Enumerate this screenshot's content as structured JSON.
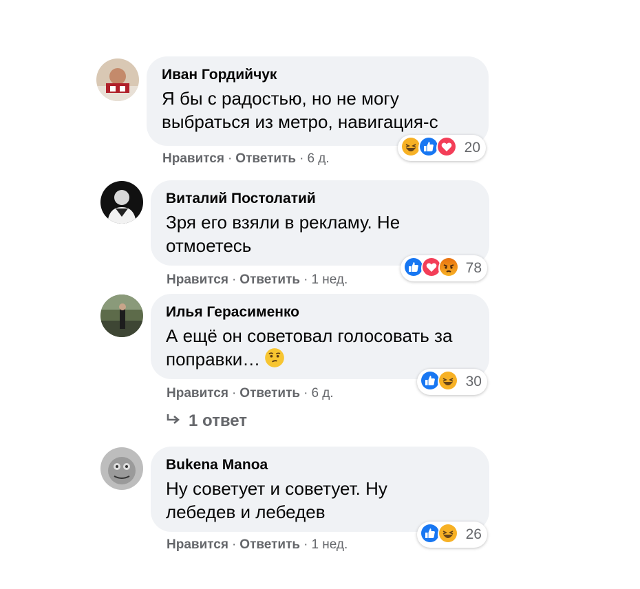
{
  "comments": [
    {
      "author": "Иван Гордийчук",
      "text": "Я бы с радостью, но не могу выбраться из метро, навигация-с",
      "like": "Нравится",
      "reply": "Ответить",
      "time": "6 д.",
      "reactions": [
        "haha",
        "like",
        "love"
      ],
      "reaction_count": "20"
    },
    {
      "author": "Виталий Постолатий",
      "text": "Зря его взяли в рекламу. Не отмоетесь",
      "like": "Нравится",
      "reply": "Ответить",
      "time": "1 нед.",
      "reactions": [
        "like",
        "love",
        "angry"
      ],
      "reaction_count": "78"
    },
    {
      "author": "Илья Герасименко",
      "text": "А ещё он советовал голосовать за поправки…",
      "like": "Нравится",
      "reply": "Ответить",
      "time": "6 д.",
      "reactions": [
        "like",
        "haha"
      ],
      "reaction_count": "30",
      "replies_link": "1 ответ"
    },
    {
      "author": "Bukena Manoa",
      "text": "Ну советует и советует. Ну лебедев и лебедев",
      "like": "Нравится",
      "reply": "Ответить",
      "time": "1 нед.",
      "reactions": [
        "like",
        "haha"
      ],
      "reaction_count": "26"
    }
  ],
  "colors": {
    "bubble": "#f0f2f5",
    "meta": "#65676b",
    "like_blue": "#1877f2",
    "love_red": "#f33e58",
    "haha_yellow": "#f7b125"
  }
}
